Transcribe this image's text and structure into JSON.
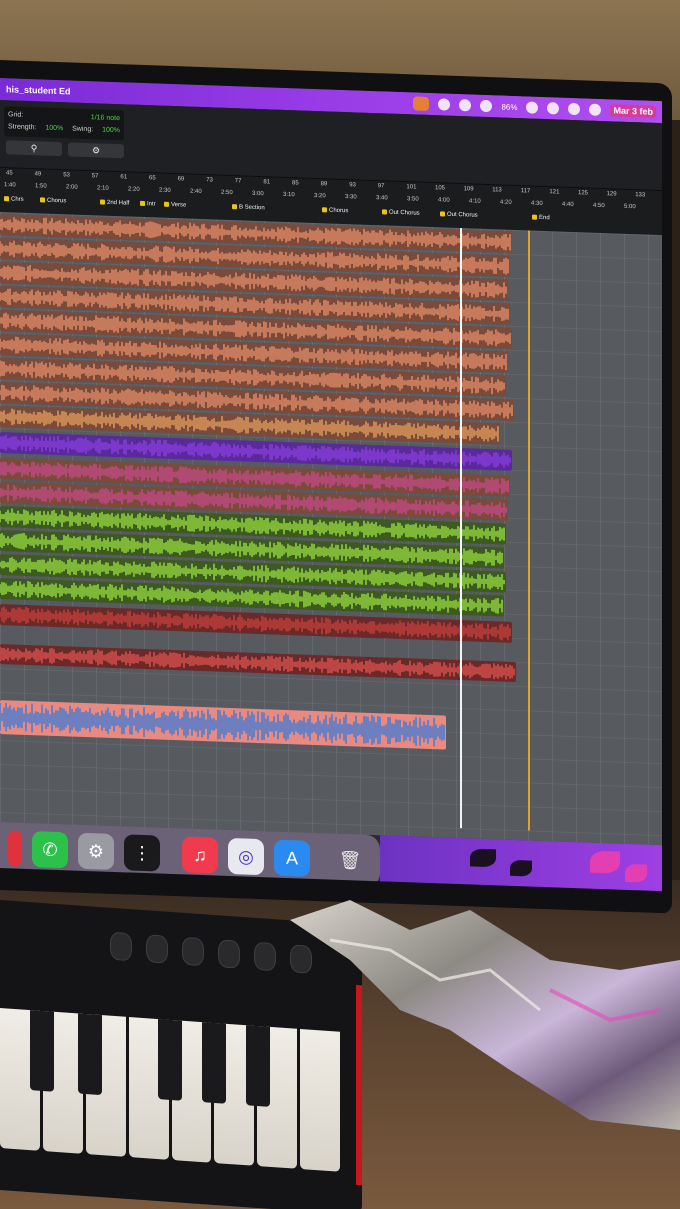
{
  "menubar": {
    "title": "his_student Ed",
    "battery": "86%",
    "date": "Mar 3 feb"
  },
  "quantize": {
    "grid_label": "Grid:",
    "grid_value": "1/16 note",
    "strength_label": "Strength:",
    "strength_value": "100%",
    "swing_label": "Swing:",
    "swing_value": "100%",
    "search_icon": "search-icon",
    "settings_icon": "gear-icon"
  },
  "ruler": {
    "bars": [
      "45",
      "49",
      "53",
      "57",
      "61",
      "65",
      "69",
      "73",
      "77",
      "81",
      "85",
      "89",
      "93",
      "97",
      "101",
      "105",
      "109",
      "113",
      "117",
      "121",
      "125",
      "129",
      "133"
    ],
    "times": [
      "1:40",
      "1:50",
      "2:00",
      "2:10",
      "2:20",
      "2:30",
      "2:40",
      "2:50",
      "3:00",
      "3:10",
      "3:20",
      "3:30",
      "3:40",
      "3:50",
      "4:00",
      "4:10",
      "4:20",
      "4:30",
      "4:40",
      "4:50",
      "5:00"
    ],
    "markers": [
      "Chrs",
      "Chorus",
      "2nd Half",
      "Intr",
      "Verse",
      "B Section",
      "Chorus",
      "Out Chorus",
      "Out Chorus",
      "End"
    ]
  },
  "tracks": [
    {
      "color": "#e8906a"
    },
    {
      "color": "#e8906a"
    },
    {
      "color": "#e8906a"
    },
    {
      "color": "#e8906a"
    },
    {
      "color": "#e8906a"
    },
    {
      "color": "#e8906a"
    },
    {
      "color": "#e8906a"
    },
    {
      "color": "#e8906a"
    },
    {
      "color": "#e8a060"
    },
    {
      "color": "#8a3ee0"
    },
    {
      "color": "#c84a8a"
    },
    {
      "color": "#c84a8a"
    },
    {
      "color": "#9ae040"
    },
    {
      "color": "#9ae040"
    },
    {
      "color": "#9ae040"
    },
    {
      "color": "#9ae040"
    },
    {
      "color": "#c8403a"
    },
    {
      "color": "#e0524e"
    },
    {
      "color": "#3a7ad8"
    }
  ],
  "dock": {
    "apps": [
      "whatsapp-icon",
      "system-settings-icon",
      "voice-memos-icon",
      "music-icon",
      "logic-icon",
      "app-store-icon",
      "trash-icon"
    ]
  },
  "colors": {
    "accent": "#9b3ee8",
    "playhead": "#f4f4f4",
    "end_marker": "#e2a32a"
  }
}
